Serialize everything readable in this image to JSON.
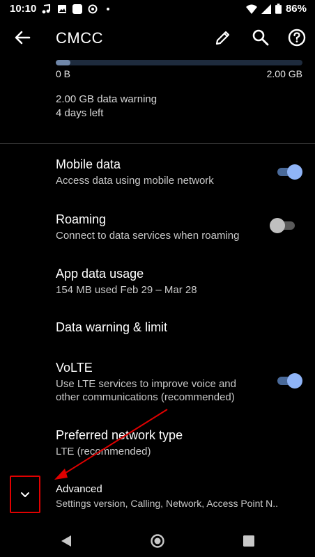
{
  "status_bar": {
    "time": "10:10",
    "battery": "86%"
  },
  "app_bar": {
    "title": "CMCC"
  },
  "usage": {
    "min_label": "0 B",
    "max_label": "2.00 GB",
    "used_fraction": 0.06,
    "warning": "2.00 GB data warning",
    "days_left": "4 days left"
  },
  "settings": [
    {
      "title": "Mobile data",
      "subtitle": "Access data using mobile network",
      "toggle": true
    },
    {
      "title": "Roaming",
      "subtitle": "Connect to data services when roaming",
      "toggle": false
    },
    {
      "title": "App data usage",
      "subtitle": "154 MB used Feb 29 – Mar 28"
    },
    {
      "title": "Data warning & limit"
    },
    {
      "title": "VoLTE",
      "subtitle_line1": "Use LTE services to improve voice and",
      "subtitle_line2": "other communications (recommended)",
      "toggle": true
    },
    {
      "title": "Preferred network type",
      "subtitle": "LTE (recommended)"
    },
    {
      "title": "Advanced",
      "subtitle": "Settings version, Calling, Network, Access Point N.."
    }
  ],
  "colors": {
    "accent": "#8fb4f7",
    "annotation": "#e00000"
  }
}
